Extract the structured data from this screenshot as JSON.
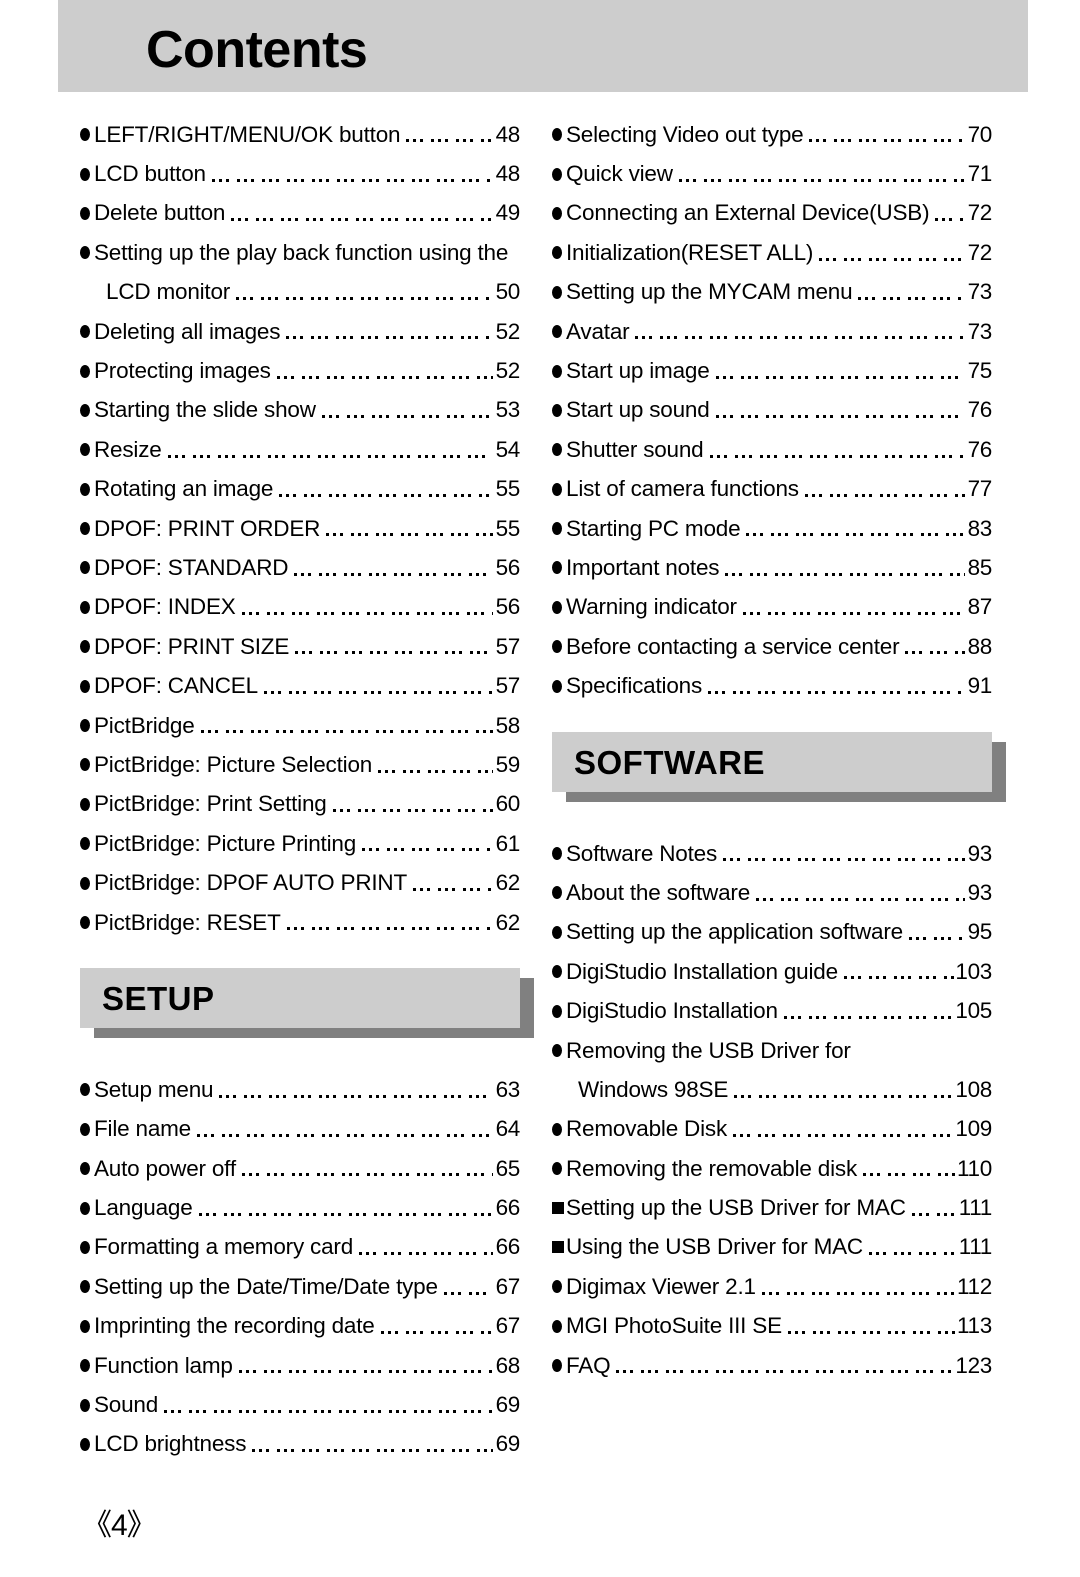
{
  "header": {
    "title": "Contents"
  },
  "footer": {
    "page_marker": "《4》"
  },
  "left_column": {
    "entries": [
      {
        "bullet": "round",
        "label": "LEFT/RIGHT/MENU/OK button",
        "page": "48"
      },
      {
        "bullet": "round",
        "label": "LCD button",
        "page": "48"
      },
      {
        "bullet": "round",
        "label": "Delete button",
        "page": "49"
      },
      {
        "bullet": "round",
        "label": "Setting up the play back function using the",
        "page": ""
      },
      {
        "bullet": "none",
        "label": "LCD monitor",
        "page": "50"
      },
      {
        "bullet": "round",
        "label": "Deleting all images",
        "page": "52"
      },
      {
        "bullet": "round",
        "label": "Protecting images",
        "page": "52"
      },
      {
        "bullet": "round",
        "label": "Starting the slide show",
        "page": "53"
      },
      {
        "bullet": "round",
        "label": "Resize",
        "page": "54"
      },
      {
        "bullet": "round",
        "label": "Rotating an image",
        "page": "55"
      },
      {
        "bullet": "round",
        "label": "DPOF: PRINT ORDER",
        "page": "55"
      },
      {
        "bullet": "round",
        "label": "DPOF: STANDARD",
        "page": "56"
      },
      {
        "bullet": "round",
        "label": "DPOF: INDEX",
        "page": "56"
      },
      {
        "bullet": "round",
        "label": "DPOF: PRINT SIZE",
        "page": "57"
      },
      {
        "bullet": "round",
        "label": "DPOF: CANCEL",
        "page": "57"
      },
      {
        "bullet": "round",
        "label": "PictBridge",
        "page": "58"
      },
      {
        "bullet": "round",
        "label": "PictBridge: Picture Selection",
        "page": "59"
      },
      {
        "bullet": "round",
        "label": "PictBridge: Print Setting",
        "page": "60"
      },
      {
        "bullet": "round",
        "label": "PictBridge: Picture Printing",
        "page": "61"
      },
      {
        "bullet": "round",
        "label": "PictBridge: DPOF AUTO PRINT",
        "page": "62"
      },
      {
        "bullet": "round",
        "label": "PictBridge: RESET",
        "page": "62"
      }
    ],
    "section": {
      "title": "SETUP"
    },
    "section_entries": [
      {
        "bullet": "round",
        "label": "Setup menu",
        "page": "63"
      },
      {
        "bullet": "round",
        "label": "File name",
        "page": "64"
      },
      {
        "bullet": "round",
        "label": "Auto power off",
        "page": "65"
      },
      {
        "bullet": "round",
        "label": "Language",
        "page": "66"
      },
      {
        "bullet": "round",
        "label": "Formatting a memory card",
        "page": "66"
      },
      {
        "bullet": "round",
        "label": "Setting up the Date/Time/Date type",
        "page": "67"
      },
      {
        "bullet": "round",
        "label": "Imprinting the recording date",
        "page": "67"
      },
      {
        "bullet": "round",
        "label": "Function lamp",
        "page": "68"
      },
      {
        "bullet": "round",
        "label": "Sound",
        "page": "69"
      },
      {
        "bullet": "round",
        "label": "LCD brightness",
        "page": "69"
      }
    ]
  },
  "right_column": {
    "entries": [
      {
        "bullet": "round",
        "label": "Selecting Video out type",
        "page": "70"
      },
      {
        "bullet": "round",
        "label": "Quick view",
        "page": "71"
      },
      {
        "bullet": "round",
        "label": "Connecting an External Device(USB)",
        "page": "72"
      },
      {
        "bullet": "round",
        "label": "Initialization(RESET ALL)",
        "page": "72"
      },
      {
        "bullet": "round",
        "label": "Setting up the MYCAM menu",
        "page": "73"
      },
      {
        "bullet": "round",
        "label": "Avatar",
        "page": "73"
      },
      {
        "bullet": "round",
        "label": "Start up image",
        "page": "75"
      },
      {
        "bullet": "round",
        "label": "Start up sound",
        "page": "76"
      },
      {
        "bullet": "round",
        "label": "Shutter sound",
        "page": "76"
      },
      {
        "bullet": "round",
        "label": "List of camera functions",
        "page": "77"
      },
      {
        "bullet": "round",
        "label": "Starting PC mode",
        "page": "83"
      },
      {
        "bullet": "round",
        "label": "Important notes",
        "page": "85"
      },
      {
        "bullet": "round",
        "label": "Warning indicator",
        "page": "87"
      },
      {
        "bullet": "round",
        "label": "Before contacting a service center",
        "page": "88"
      },
      {
        "bullet": "round",
        "label": "Specifications",
        "page": "91"
      }
    ],
    "section": {
      "title": "SOFTWARE"
    },
    "section_entries": [
      {
        "bullet": "round",
        "label": "Software Notes",
        "page": "93"
      },
      {
        "bullet": "round",
        "label": "About the software",
        "page": "93"
      },
      {
        "bullet": "round",
        "label": "Setting up the application software",
        "page": "95"
      },
      {
        "bullet": "round",
        "label": "DigiStudio Installation guide",
        "page": "103"
      },
      {
        "bullet": "round",
        "label": "DigiStudio Installation",
        "page": "105"
      },
      {
        "bullet": "round",
        "label": "Removing the USB Driver for",
        "page": ""
      },
      {
        "bullet": "none",
        "label": "Windows 98SE",
        "page": "108"
      },
      {
        "bullet": "round",
        "label": "Removable Disk",
        "page": "109"
      },
      {
        "bullet": "round",
        "label": "Removing the removable disk",
        "page": "110"
      },
      {
        "bullet": "square",
        "label": "Setting up the USB Driver for MAC",
        "page": "111"
      },
      {
        "bullet": "square",
        "label": "Using the USB Driver for MAC",
        "page": "111"
      },
      {
        "bullet": "round",
        "label": "Digimax Viewer 2.1",
        "page": "112"
      },
      {
        "bullet": "round",
        "label": "MGI PhotoSuite III SE",
        "page": "113"
      },
      {
        "bullet": "round",
        "label": "FAQ",
        "page": "123"
      }
    ]
  }
}
